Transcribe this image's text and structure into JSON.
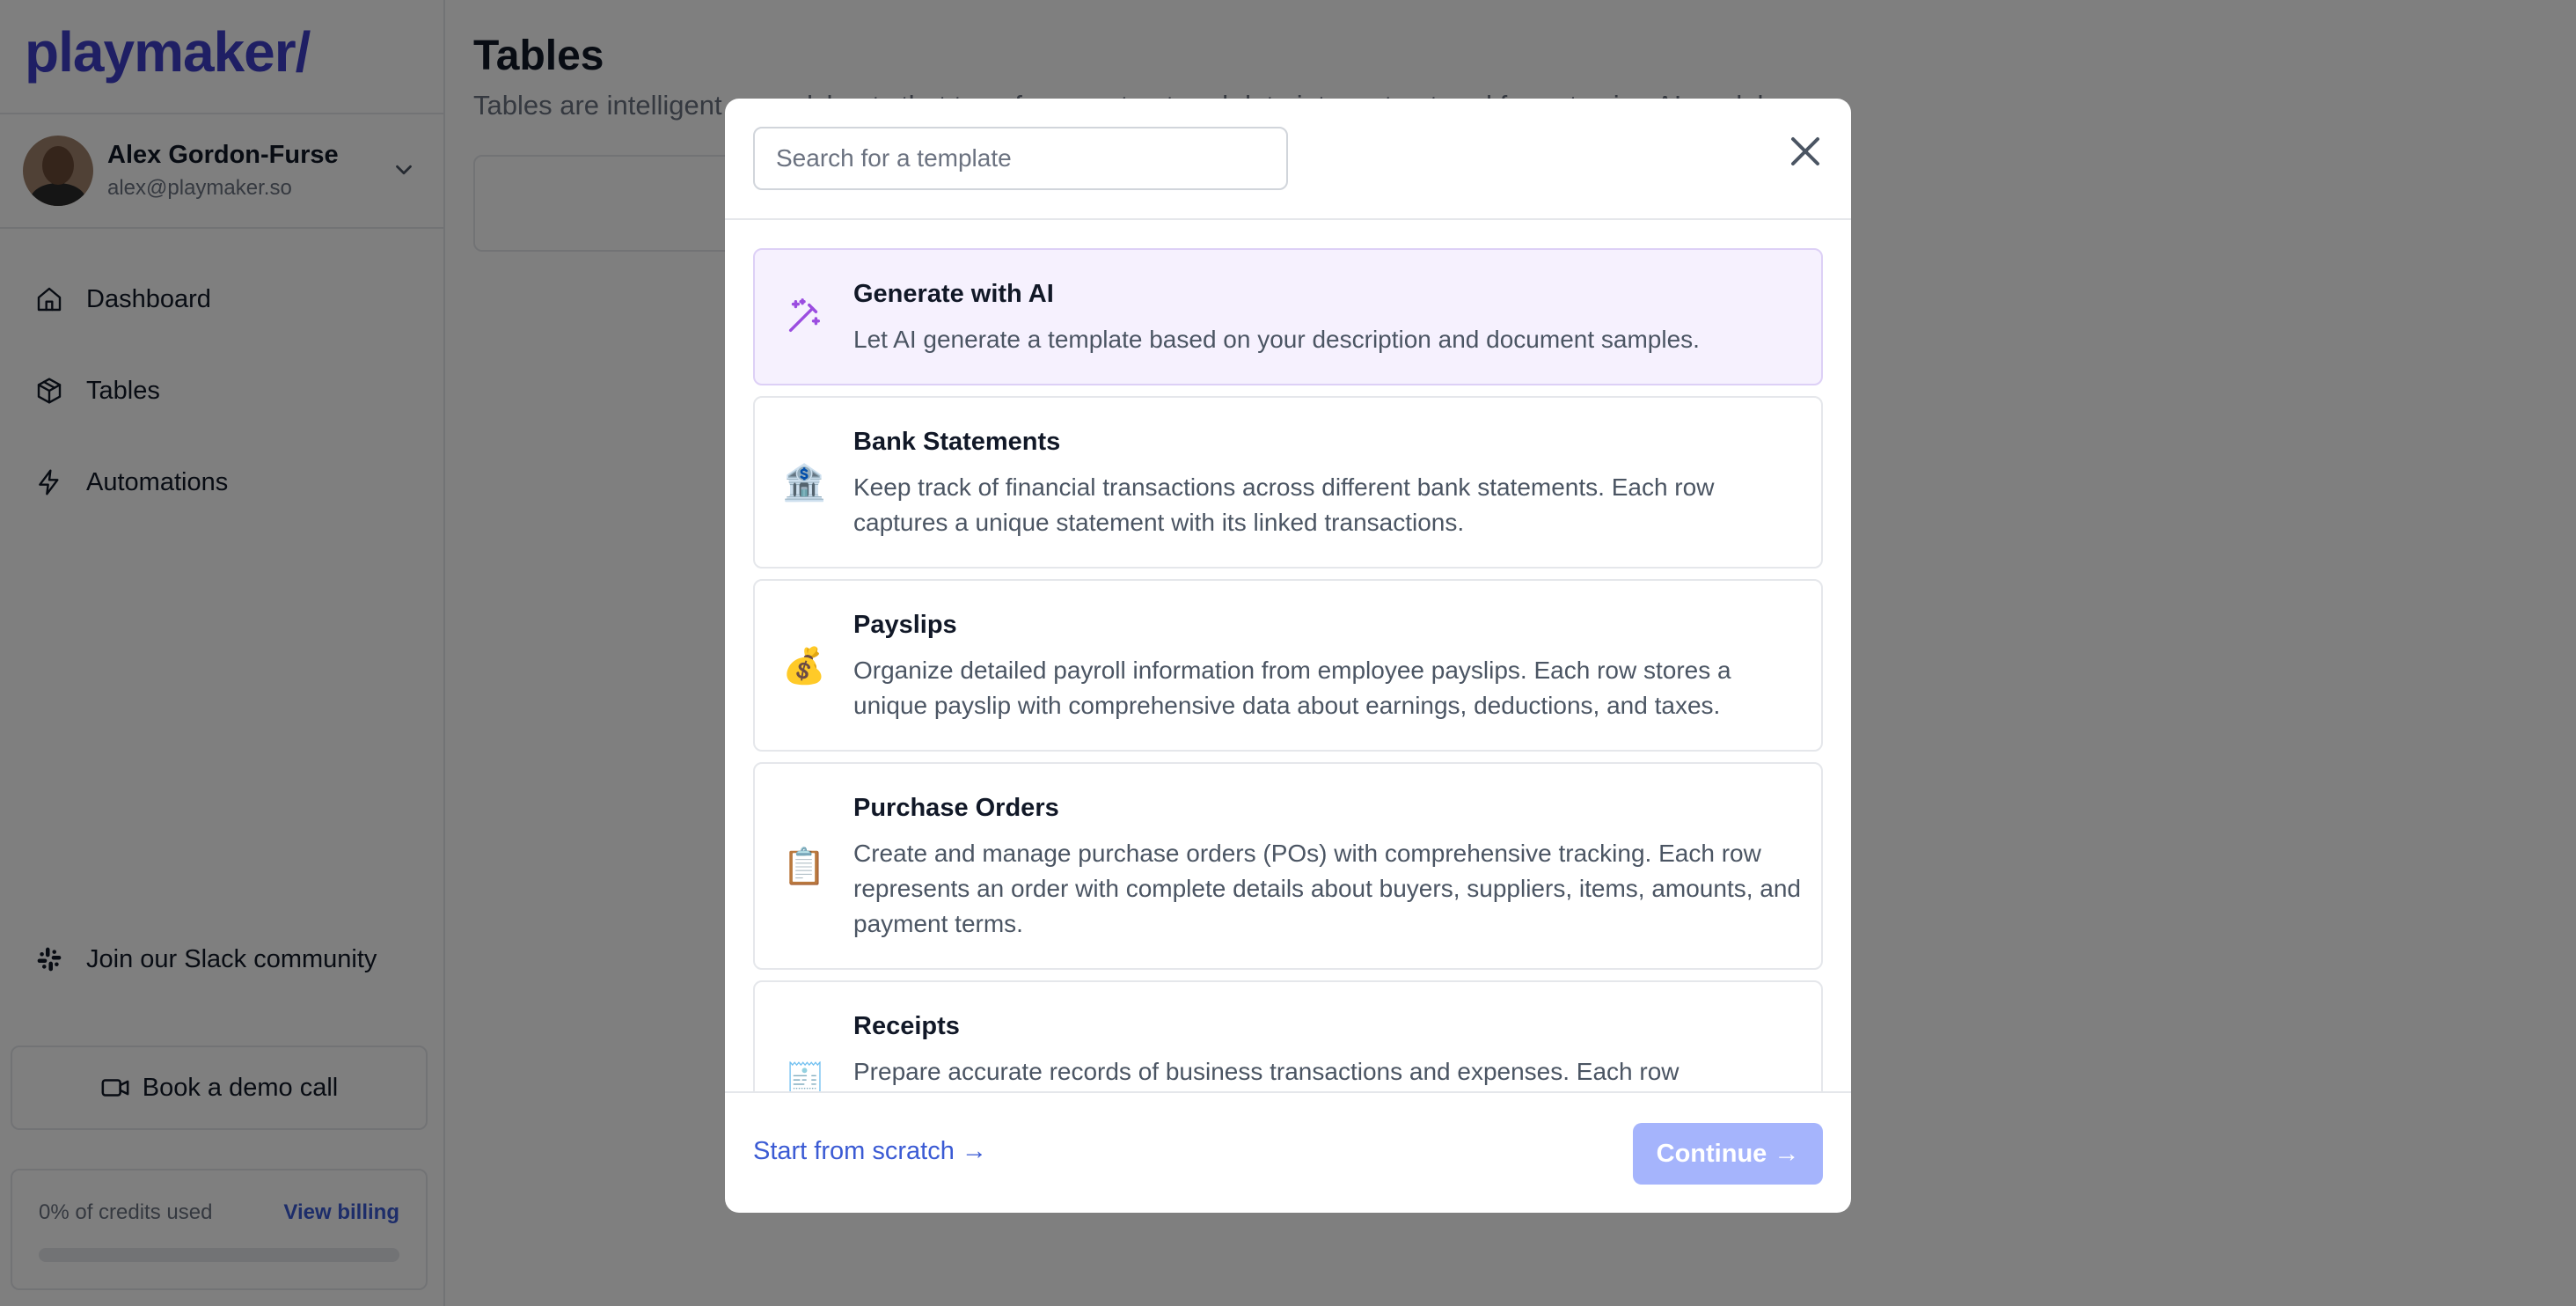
{
  "sidebar": {
    "logo": "playmaker/",
    "user": {
      "name": "Alex Gordon-Furse",
      "email": "alex@playmaker.so"
    },
    "nav": [
      {
        "label": "Dashboard",
        "icon": "home-icon"
      },
      {
        "label": "Tables",
        "icon": "box-icon"
      },
      {
        "label": "Automations",
        "icon": "lightning-icon"
      }
    ],
    "slack_label": "Join our Slack community",
    "demo_label": "Book a demo call",
    "credits": {
      "text": "0% of credits used",
      "billing": "View billing",
      "used_fraction": 0
    }
  },
  "main": {
    "title": "Tables",
    "subtitle": "Tables are intelligent spreadsheets that transform unstructured data into a structured format using AI models."
  },
  "modal": {
    "search_placeholder": "Search for a template",
    "templates": [
      {
        "title": "Generate with AI",
        "desc": "Let AI generate a template based on your description and document samples.",
        "icon": "magic-wand-icon",
        "selected": true
      },
      {
        "title": "Bank Statements",
        "desc": "Keep track of financial transactions across different bank statements. Each row captures a unique statement with its linked transactions.",
        "icon": "🏦"
      },
      {
        "title": "Payslips",
        "desc": "Organize detailed payroll information from employee payslips. Each row stores a unique payslip with comprehensive data about earnings, deductions, and taxes.",
        "icon": "💰"
      },
      {
        "title": "Purchase Orders",
        "desc": "Create and manage purchase orders (POs) with comprehensive tracking. Each row represents an order with complete details about buyers, suppliers, items, amounts, and payment terms.",
        "icon": "📋"
      },
      {
        "title": "Receipts",
        "desc": "Prepare accurate records of business transactions and expenses. Each row",
        "icon": "🧾"
      }
    ],
    "scratch_label": "Start from scratch →",
    "continue_label": "Continue →"
  },
  "colors": {
    "brand": "#3f3fc8",
    "accent": "#3b5bd4",
    "selected_bg": "#f6f1fe",
    "continue_disabled": "#a5b4fc",
    "ai_icon": "#9b4de0"
  }
}
